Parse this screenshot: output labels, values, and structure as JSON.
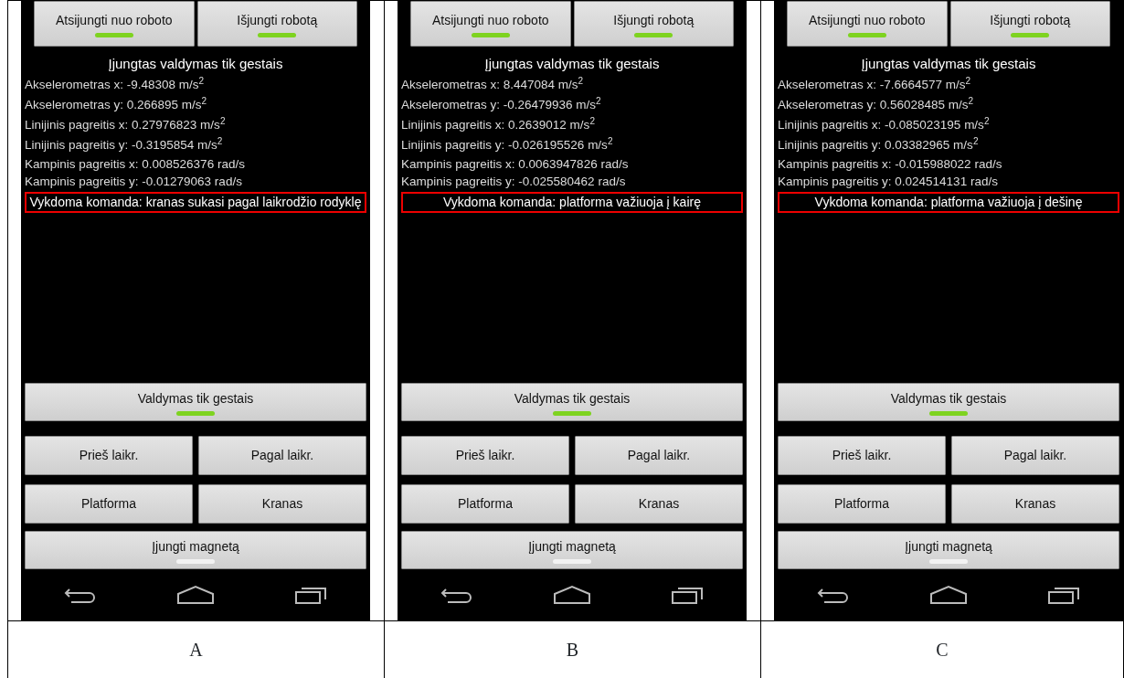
{
  "panels": [
    {
      "label": "A",
      "top_buttons": [
        {
          "label": "Atsijungti nuo roboto",
          "on": true
        },
        {
          "label": "Išjungti robotą",
          "on": true
        }
      ],
      "status": "Įjungtas valdymas tik gestais",
      "readings": [
        "Akselerometras x: -9.48308 m/s$^{2}$",
        "Akselerometras y: 0.266895 m/s$^{2}$",
        "Linijinis pagreitis x: 0.27976823 m/s$^{2}$",
        "Linijinis pagreitis y: -0.3195854 m/s$^{2}$",
        "Kampinis pagreitis x: 0.008526376 rad/s",
        "Kampinis pagreitis y: -0.01279063 rad/s"
      ],
      "command": "Vykdoma komanda: kranas sukasi pagal laikrodžio rodyklę",
      "gesture_toggle": {
        "label": "Valdymas tik gestais",
        "on": true
      },
      "buttons": [
        "Prieš laikr.",
        "Pagal laikr.",
        "Platforma",
        "Kranas"
      ],
      "magnet_toggle": {
        "label": "Įjungti magnetą",
        "on": false
      }
    },
    {
      "label": "B",
      "top_buttons": [
        {
          "label": "Atsijungti nuo roboto",
          "on": true
        },
        {
          "label": "Išjungti robotą",
          "on": true
        }
      ],
      "status": "Įjungtas valdymas tik gestais",
      "readings": [
        "Akselerometras x: 8.447084 m/s$^{2}$",
        "Akselerometras y: -0.26479936 m/s$^{2}$",
        "Linijinis pagreitis x: 0.2639012 m/s$^{2}$",
        "Linijinis pagreitis y: -0.026195526 m/s$^{2}$",
        "Kampinis pagreitis x: 0.0063947826 rad/s",
        "Kampinis pagreitis y: -0.025580462 rad/s"
      ],
      "command": "Vykdoma komanda: platforma važiuoja į kairę",
      "gesture_toggle": {
        "label": "Valdymas tik gestais",
        "on": true
      },
      "buttons": [
        "Prieš laikr.",
        "Pagal laikr.",
        "Platforma",
        "Kranas"
      ],
      "magnet_toggle": {
        "label": "Įjungti magnetą",
        "on": false
      }
    },
    {
      "label": "C",
      "top_buttons": [
        {
          "label": "Atsijungti nuo roboto",
          "on": true
        },
        {
          "label": "Išjungti robotą",
          "on": true
        }
      ],
      "status": "Įjungtas valdymas tik gestais",
      "readings": [
        "Akselerometras x: -7.6664577 m/s$^{2}$",
        "Akselerometras y: 0.56028485 m/s$^{2}$",
        "Linijinis pagreitis x: -0.085023195 m/s$^{2}$",
        "Linijinis pagreitis y: 0.03382965 m/s$^{2}$",
        "Kampinis pagreitis x: -0.015988022 rad/s",
        "Kampinis pagreitis y: 0.024514131 rad/s"
      ],
      "command": "Vykdoma komanda: platforma važiuoja į dešinę",
      "gesture_toggle": {
        "label": "Valdymas tik gestais",
        "on": true
      },
      "buttons": [
        "Prieš laikr.",
        "Pagal laikr.",
        "Platforma",
        "Kranas"
      ],
      "magnet_toggle": {
        "label": "Įjungti magnetą",
        "on": false
      }
    }
  ]
}
